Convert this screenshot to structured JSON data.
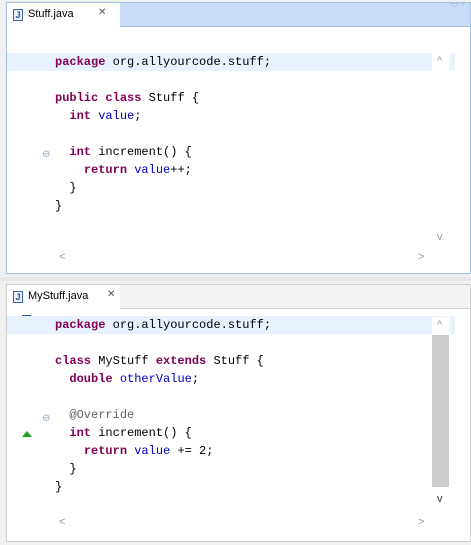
{
  "editors": [
    {
      "tab_label": "Stuff.java",
      "tab_icon": "java-file-icon",
      "lines": [
        {
          "segments": [
            {
              "t": "package",
              "k": "kw"
            },
            {
              "t": " org.allyourcode.stuff;",
              "k": ""
            }
          ],
          "current": true
        },
        {
          "segments": []
        },
        {
          "segments": [
            {
              "t": "public",
              "k": "kw"
            },
            {
              "t": " ",
              "k": ""
            },
            {
              "t": "class",
              "k": "kw"
            },
            {
              "t": " Stuff {",
              "k": ""
            }
          ]
        },
        {
          "segments": [
            {
              "t": "  ",
              "k": ""
            },
            {
              "t": "int",
              "k": "kw"
            },
            {
              "t": " ",
              "k": ""
            },
            {
              "t": "value",
              "k": "fld"
            },
            {
              "t": ";",
              "k": ""
            }
          ]
        },
        {
          "segments": []
        },
        {
          "segments": [
            {
              "t": "  ",
              "k": ""
            },
            {
              "t": "int",
              "k": "kw"
            },
            {
              "t": " increment() {",
              "k": ""
            }
          ]
        },
        {
          "segments": [
            {
              "t": "    ",
              "k": ""
            },
            {
              "t": "return",
              "k": "kw"
            },
            {
              "t": " ",
              "k": ""
            },
            {
              "t": "value",
              "k": "fld"
            },
            {
              "t": "++;",
              "k": ""
            }
          ]
        },
        {
          "segments": [
            {
              "t": "  }",
              "k": ""
            }
          ]
        },
        {
          "segments": [
            {
              "t": "}",
              "k": ""
            }
          ]
        }
      ]
    },
    {
      "tab_label": "MyStuff.java",
      "tab_icon": "java-file-icon",
      "lines": [
        {
          "segments": [
            {
              "t": "package",
              "k": "kw"
            },
            {
              "t": " org.allyourcode.stuff;",
              "k": ""
            }
          ],
          "current": true
        },
        {
          "segments": []
        },
        {
          "segments": [
            {
              "t": "class",
              "k": "kw"
            },
            {
              "t": " MyStuff ",
              "k": ""
            },
            {
              "t": "extends",
              "k": "kw"
            },
            {
              "t": " Stuff {",
              "k": ""
            }
          ]
        },
        {
          "segments": [
            {
              "t": "  ",
              "k": ""
            },
            {
              "t": "double",
              "k": "kw"
            },
            {
              "t": " ",
              "k": ""
            },
            {
              "t": "otherValue",
              "k": "fld"
            },
            {
              "t": ";",
              "k": ""
            }
          ]
        },
        {
          "segments": []
        },
        {
          "segments": [
            {
              "t": "  ",
              "k": ""
            },
            {
              "t": "@Override",
              "k": "ann"
            }
          ]
        },
        {
          "segments": [
            {
              "t": "  ",
              "k": ""
            },
            {
              "t": "int",
              "k": "kw"
            },
            {
              "t": " increment() {",
              "k": ""
            }
          ]
        },
        {
          "segments": [
            {
              "t": "    ",
              "k": ""
            },
            {
              "t": "return",
              "k": "kw"
            },
            {
              "t": " ",
              "k": ""
            },
            {
              "t": "value",
              "k": "fld"
            },
            {
              "t": " += 2;",
              "k": ""
            }
          ]
        },
        {
          "segments": [
            {
              "t": "  }",
              "k": ""
            }
          ]
        },
        {
          "segments": [
            {
              "t": "}",
              "k": ""
            }
          ]
        }
      ]
    }
  ],
  "icons": {
    "close": "✕",
    "fold": "⊖",
    "arrow_up": "^",
    "arrow_down": "v",
    "arrow_left": "<",
    "arrow_right": ">",
    "java_letter": "J"
  },
  "colors": {
    "keyword": "#7f0055",
    "field": "#0000c0",
    "annotation": "#646464",
    "current_line": "#e8f2fe",
    "active_tab_bar": "#c9dcf6"
  }
}
